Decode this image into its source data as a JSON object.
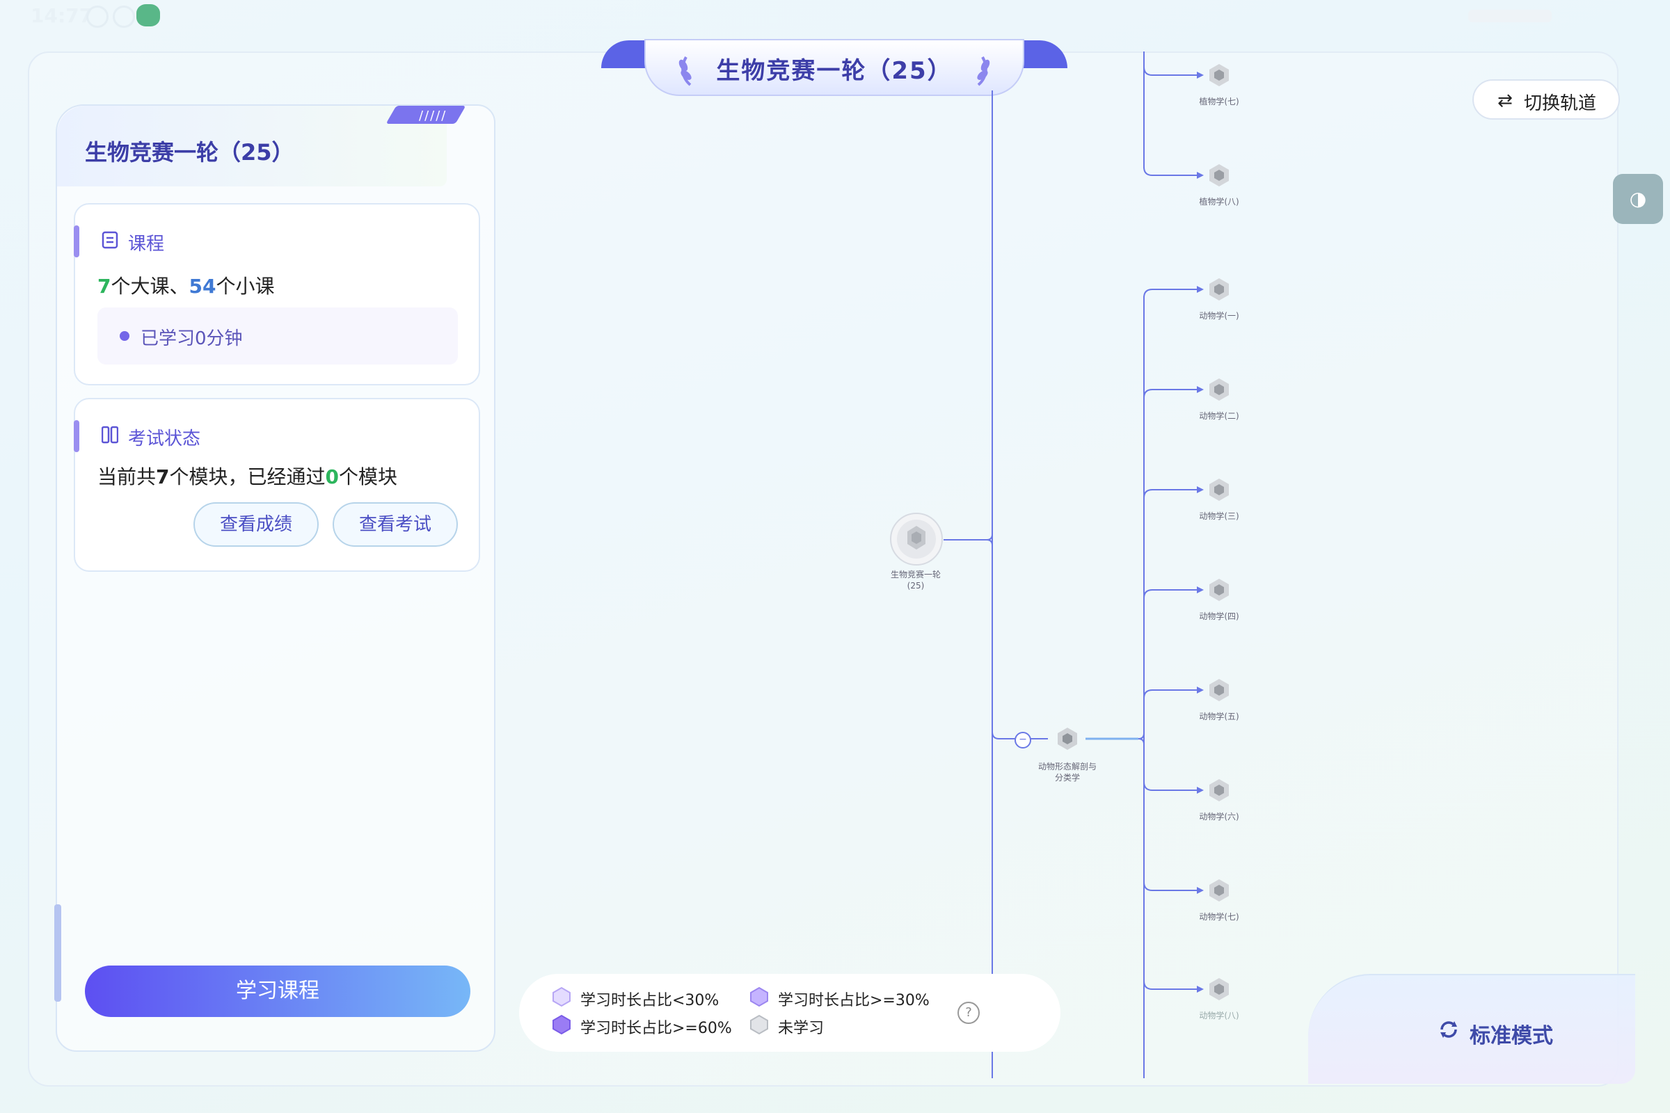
{
  "status_bar": {
    "time": "14:77"
  },
  "banner": {
    "title": "生物竞赛一轮（25）"
  },
  "left_panel": {
    "title": "生物竞赛一轮（25）",
    "course": {
      "title": "课程",
      "big_count": "7",
      "big_suffix": "个大课、",
      "small_count": "54",
      "small_suffix": "个小课",
      "studied": "已学习0分钟"
    },
    "exam": {
      "title": "考试状态",
      "text_prefix": "当前共",
      "modules_total": "7",
      "text_mid": "个模块，已经通过",
      "modules_passed": "0",
      "text_suffix": "个模块",
      "view_score": "查看成绩",
      "view_exam": "查看考试"
    },
    "study_button": "学习课程"
  },
  "tree": {
    "root": {
      "label_line1": "生物竞赛一轮",
      "label_line2": "(25)"
    },
    "branch": {
      "label_line1": "动物形态解剖与",
      "label_line2": "分类学",
      "toggle": "−"
    },
    "top_leaves": [
      "植物学(七)",
      "植物学(八)"
    ],
    "leaves": [
      "动物学(一)",
      "动物学(二)",
      "动物学(三)",
      "动物学(四)",
      "动物学(五)",
      "动物学(六)",
      "动物学(七)",
      "动物学(八)"
    ]
  },
  "controls": {
    "switch_track": "切换轨道",
    "switch_icon": "⇄",
    "contrast_icon": "◑",
    "mode_label": "标准模式"
  },
  "legend": {
    "items": [
      "学习时长占比<30%",
      "学习时长占比>=30%",
      "学习时长占比>=60%",
      "未学习"
    ],
    "help": "?"
  },
  "colors": {
    "accent": "#5b63e6",
    "title": "#3d3ea8",
    "green": "#2db55d",
    "blue": "#3f79d4",
    "line": "#6a78e6"
  }
}
